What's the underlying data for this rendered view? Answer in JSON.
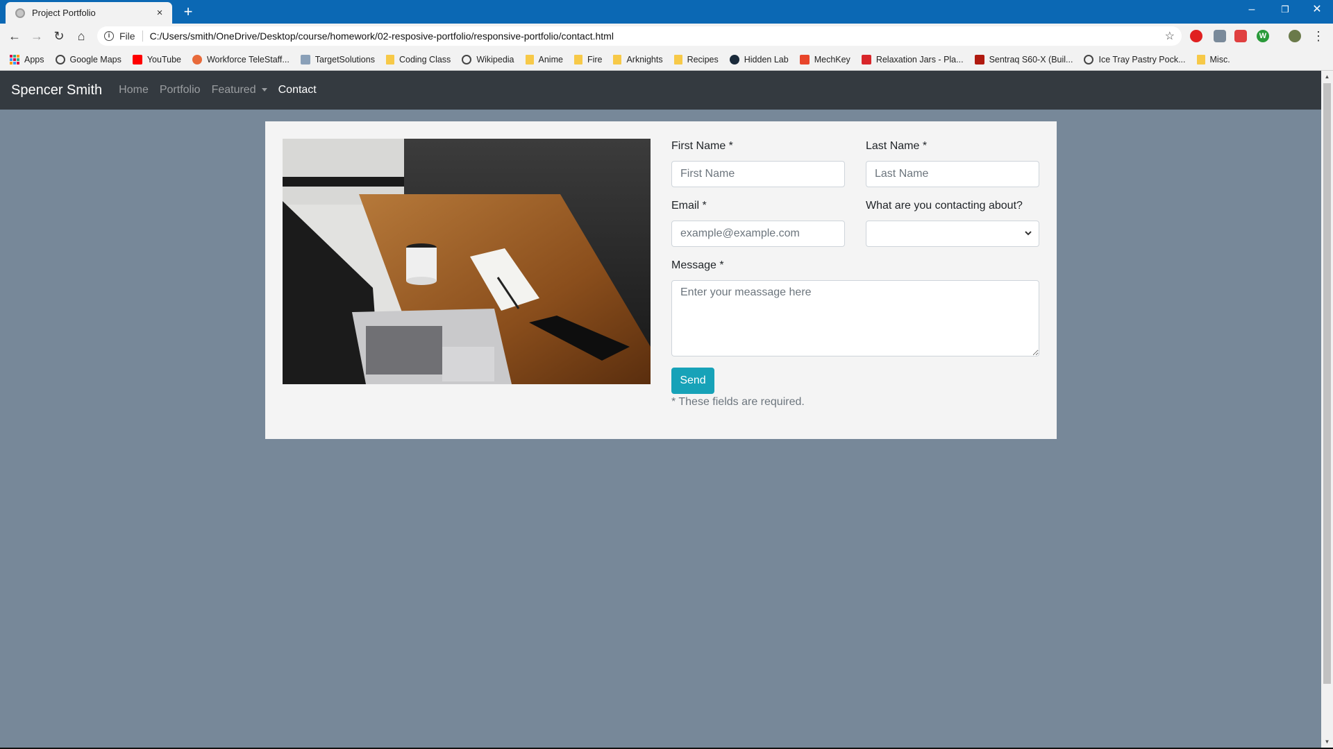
{
  "browser": {
    "tab_title": "Project Portfolio",
    "tab_close": "×",
    "new_tab": "+",
    "scheme": "File",
    "url": "C:/Users/smith/OneDrive/Desktop/course/homework/02-resposive-portfolio/responsive-portfolio/contact.html",
    "window_controls": {
      "minimize": "–",
      "restore": "❐",
      "close": "✕"
    },
    "nav": {
      "back": "←",
      "forward": "→",
      "reload": "↻",
      "home": "⌂",
      "star": "☆",
      "menu": "⋮"
    }
  },
  "bookmarks": [
    {
      "label": "Apps",
      "icon": "apps-icon"
    },
    {
      "label": "Google Maps",
      "icon": "globe-icon"
    },
    {
      "label": "YouTube",
      "icon": "youtube-icon"
    },
    {
      "label": "Workforce TeleStaff...",
      "icon": "site-icon"
    },
    {
      "label": "TargetSolutions",
      "icon": "site-icon"
    },
    {
      "label": "Coding Class",
      "icon": "folder-icon"
    },
    {
      "label": "Wikipedia",
      "icon": "globe-icon"
    },
    {
      "label": "Anime",
      "icon": "folder-icon"
    },
    {
      "label": "Fire",
      "icon": "folder-icon"
    },
    {
      "label": "Arknights",
      "icon": "folder-icon"
    },
    {
      "label": "Recipes",
      "icon": "folder-icon"
    },
    {
      "label": "Hidden Lab",
      "icon": "site-icon"
    },
    {
      "label": "MechKey",
      "icon": "site-icon"
    },
    {
      "label": "Relaxation Jars - Pla...",
      "icon": "site-icon"
    },
    {
      "label": "Sentraq S60-X (Buil...",
      "icon": "site-icon"
    },
    {
      "label": "Ice Tray Pastry Pock...",
      "icon": "globe-icon"
    },
    {
      "label": "Misc.",
      "icon": "folder-icon"
    }
  ],
  "site": {
    "brand": "Spencer Smith",
    "nav": {
      "home": "Home",
      "portfolio": "Portfolio",
      "featured": "Featured",
      "contact": "Contact"
    }
  },
  "form": {
    "first_name_label": "First Name *",
    "first_name_placeholder": "First Name",
    "last_name_label": "Last Name *",
    "last_name_placeholder": "Last Name",
    "email_label": "Email *",
    "email_placeholder": "example@example.com",
    "topic_label": "What are you contacting about?",
    "topic_selected": "",
    "message_label": "Message *",
    "message_placeholder": "Enter your meassage here",
    "send_label": "Send",
    "required_note": "* These fields are required."
  },
  "colors": {
    "page_bg": "#778899",
    "navbar_bg": "#343a40",
    "accent_button": "#17a2b8",
    "titlebar": "#0b68b4"
  }
}
